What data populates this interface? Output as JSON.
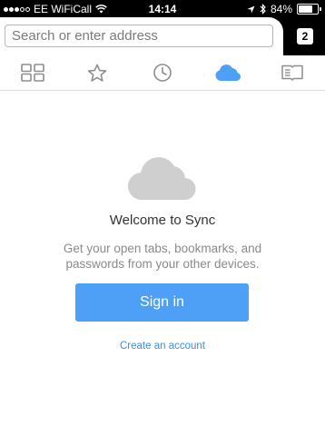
{
  "status_bar": {
    "carrier": "EE WiFiCall",
    "time": "14:14",
    "battery_percent": "84%",
    "battery_level": 0.84,
    "signal_bars_filled": 3,
    "signal_bars_total": 5
  },
  "toolbar": {
    "address_placeholder": "Search or enter address",
    "tab_count": "2"
  },
  "tabs": [
    {
      "icon": "top-sites-grid-icon",
      "active": false
    },
    {
      "icon": "bookmarks-star-icon",
      "active": false
    },
    {
      "icon": "history-clock-icon",
      "active": false
    },
    {
      "icon": "synced-tabs-cloud-icon",
      "active": true
    },
    {
      "icon": "reading-list-icon",
      "active": false
    }
  ],
  "sync_panel": {
    "icon": "cloud-icon",
    "title": "Welcome to Sync",
    "description": "Get your open tabs, bookmarks, and passwords from your other devices.",
    "sign_in_label": "Sign in",
    "create_account_label": "Create an account"
  },
  "colors": {
    "accent": "#4ea0f7",
    "link": "#3a8de2",
    "icon_gray": "#8e8e8e",
    "cloud_gray": "#cfcfcf"
  }
}
